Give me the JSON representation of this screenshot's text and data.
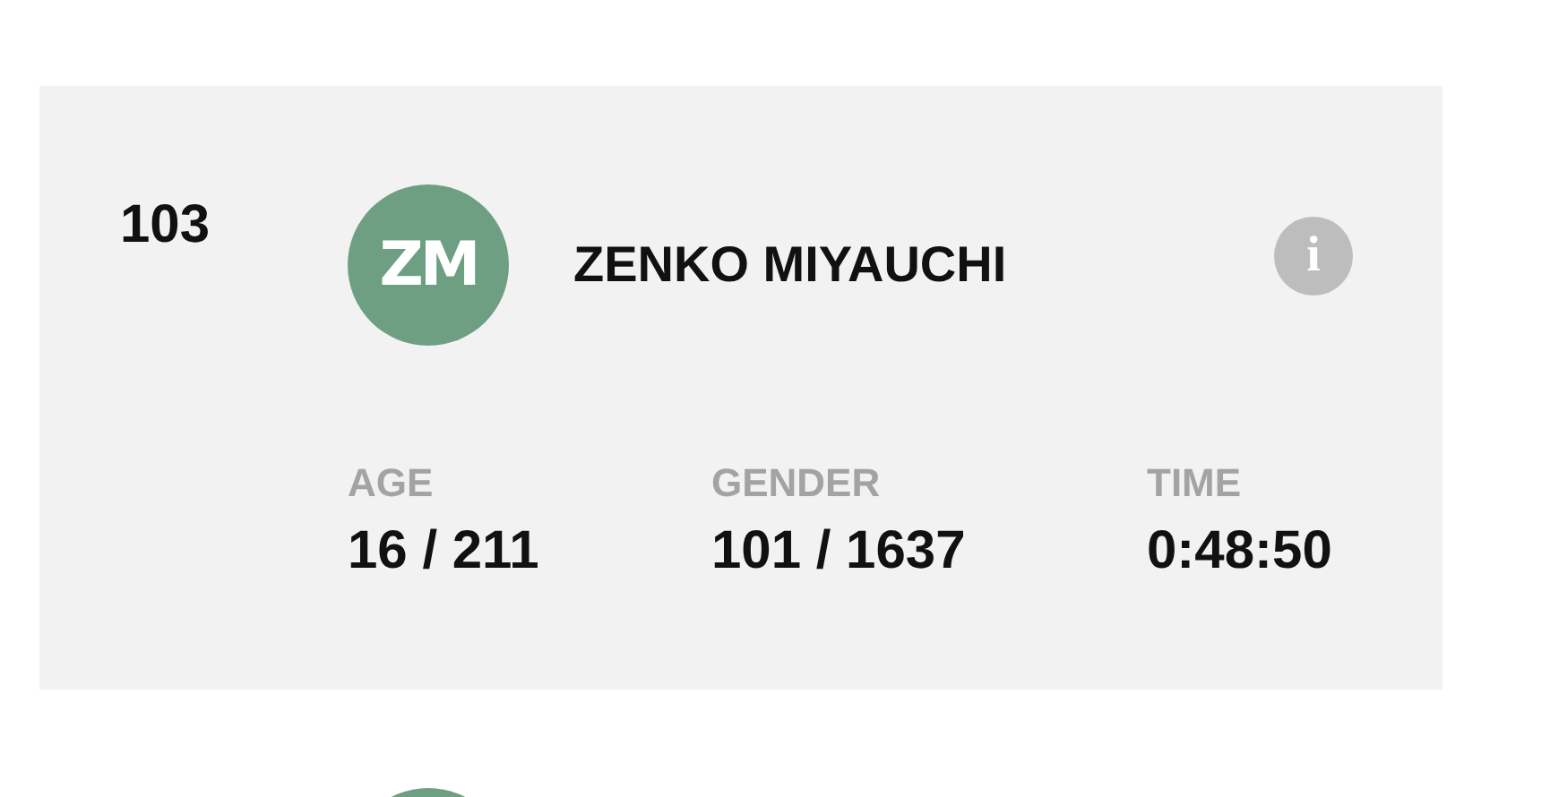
{
  "entry": {
    "rank": "103",
    "initials": "ZM",
    "name": "ZENKO MIYAUCHI",
    "info": "i",
    "stats": [
      {
        "label": "AGE",
        "value": "16 / 211"
      },
      {
        "label": "GENDER",
        "value": "101 / 1637"
      },
      {
        "label": "TIME",
        "value": "0:48:50"
      }
    ]
  },
  "next_entry": {
    "kind": "avatar"
  }
}
